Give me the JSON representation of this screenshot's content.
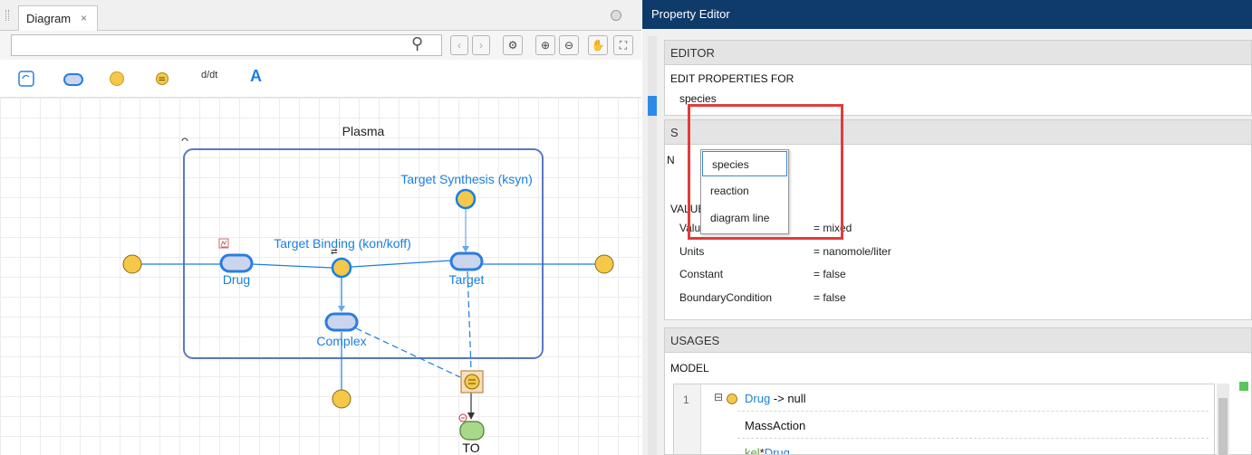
{
  "diagram": {
    "tab_label": "Diagram",
    "tab_close": "×",
    "search_value": "",
    "search_placeholder": "",
    "compartment_label": "Plasma",
    "labels": {
      "target_synthesis": "Target Synthesis (ksyn)",
      "target_binding": "Target Binding (kon/koff)",
      "drug": "Drug",
      "target": "Target",
      "complex": "Complex",
      "to": "TO"
    },
    "palette_text_tool": "A",
    "palette_rate_tool": "d/dt"
  },
  "property_editor": {
    "title": "Property Editor",
    "editor_section": "EDITOR",
    "edit_properties_label": "EDIT PROPERTIES FOR",
    "edit_properties_value": "species",
    "dropdown_options": [
      "species",
      "reaction",
      "diagram line"
    ],
    "partial_label_s": "S",
    "partial_label_n": "N",
    "value_section_label": "VALUE",
    "properties": [
      {
        "name": "Value",
        "value": "=  mixed"
      },
      {
        "name": "Units",
        "value": "=  nanomole/liter"
      },
      {
        "name": "Constant",
        "value": "= false"
      },
      {
        "name": "BoundaryCondition",
        "value": "= false"
      }
    ],
    "usages_section": "USAGES",
    "model_label": "MODEL",
    "usage_rows": {
      "line_number": "1",
      "expand_symbol": "⊟",
      "reaction_species": "Drug",
      "reaction_rest": " -> null",
      "kinetic_law": "MassAction",
      "rate_param": "kel",
      "rate_op": "*",
      "rate_species": "Drug"
    }
  },
  "colors": {
    "header_bg": "#0f3b6b",
    "species_fill": "#cdd5ee",
    "species_stroke": "#2a7de1",
    "node_fill": "#f5c84a",
    "link_blue": "#1a7fe0",
    "highlight_red": "#e03c3c",
    "param_green": "#5aa02c"
  }
}
